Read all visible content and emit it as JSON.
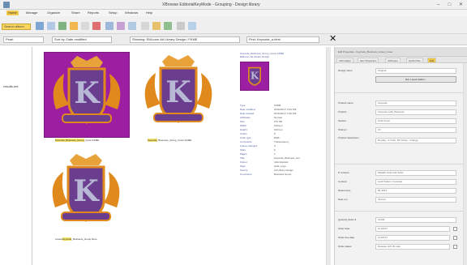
{
  "window": {
    "title": "XBrowse EditorialKeyMode - Grouping - Design library",
    "minimize": "–",
    "maximize": "□",
    "close": "✕"
  },
  "menu": {
    "items": [
      "Home",
      "Manage",
      "Organize",
      "Share",
      "Reports",
      "Setup",
      "Windows",
      "Help"
    ]
  },
  "toolbar": {
    "left_button": "Search album",
    "filter_label": "Pearl",
    "sort_field": "Sort by: Date modified",
    "path_field": "Showing: EMLcom Ad Library Design / FKME",
    "search_placeholder": "Find: Keycode_a.html"
  },
  "leftpane": {
    "item_label": "results.ent"
  },
  "thumbnails": [
    {
      "caption_pre": "",
      "caption_hl": "Keycode_Business_Group",
      "caption_post": "_Cover.FKME",
      "selected": true,
      "bg": "#9b1fa0"
    },
    {
      "caption_pre": "",
      "caption_hl": "Keycode",
      "caption_post": "_Business_Group_Cover.FKME",
      "selected": false,
      "bg": "#ffffff"
    },
    {
      "caption_pre": "Lowes",
      "caption_hl": "Keycode",
      "caption_post": "_Business_Group.fkme",
      "selected": false,
      "bg": "#ffffff"
    }
  ],
  "details": {
    "filename": "Keycode_Business_Group_Cover.FKME",
    "subtitle": "EMLcom Ad Library Design",
    "rows": [
      {
        "k": "Type",
        "v": "FKME"
      },
      {
        "k": "Date modified",
        "v": "2019-08-17 3:42 PM"
      },
      {
        "k": "Date created",
        "v": "2019-08-17 3:40 PM"
      },
      {
        "k": "Attributes",
        "v": "Normal"
      },
      {
        "k": "Size",
        "v": "274 KB"
      },
      {
        "k": "Width",
        "v": "1024 px"
      },
      {
        "k": "Height",
        "v": "1024 px"
      },
      {
        "k": "Colors",
        "v": "8"
      },
      {
        "k": "Color type",
        "v": "RGB"
      },
      {
        "k": "Comments",
        "v": "Transparency"
      },
      {
        "k": "Frame changed",
        "v": "0"
      },
      {
        "k": "Stars",
        "v": "0"
      },
      {
        "k": "Pages",
        "v": "1"
      },
      {
        "k": "Title",
        "v": "Keycode_Business_Gro"
      },
      {
        "k": "Owner",
        "v": "Administrator"
      },
      {
        "k": "Tags",
        "v": "Gold, Logo"
      },
      {
        "k": "Source",
        "v": "Ad Library Design"
      },
      {
        "k": "Comments",
        "v": "Business Group"
      }
    ]
  },
  "rightpane": {
    "title": "Edit Properties - Keycode_Business_Group_Cover",
    "tabs": [
      "Information",
      "Item Properties",
      "Attributes",
      "Quick Files",
      "Edit"
    ],
    "active_tab": "Edit",
    "fields": {
      "design_name_label": "Design name",
      "design_name_value": "Original",
      "open_button": "Run Layout Editor...",
      "product_name_label": "Product name",
      "product_name_value": "Keycode",
      "product_label": "Product",
      "product_value": "Keycode Gold_Business",
      "section_label": "Section",
      "section_value": "Gold Cover",
      "total_pc_label": "Total pc",
      "total_pc_value": "16",
      "product_info_label": "Product description",
      "product_info_value": "Royalty - 2 Color, 60 Inches - Orange",
      "pcb_label": "P. Colours",
      "pcb_value": "Metallic Gold and Violet",
      "content_label": "Content",
      "content_value": "Gold Pattern, Forecast",
      "references_label": "References",
      "references_value": "B1-2011",
      "date_run_label": "Date run",
      "date_run_value": "24-Feb",
      "quantity_label": "Quantity Order #",
      "quantity_value": "12345",
      "order_date_label": "Order date",
      "order_date_value": "12-09-07",
      "order_due_label": "Order due date",
      "order_due_value": "12-09-07",
      "order_status_label": "Order status",
      "order_status_value": "Release Gift UK sale"
    }
  },
  "colors": {
    "accent": "#f0c84a",
    "purple": "#9b1fa0",
    "gold": "#e08a1e",
    "link": "#4a5c9a"
  }
}
